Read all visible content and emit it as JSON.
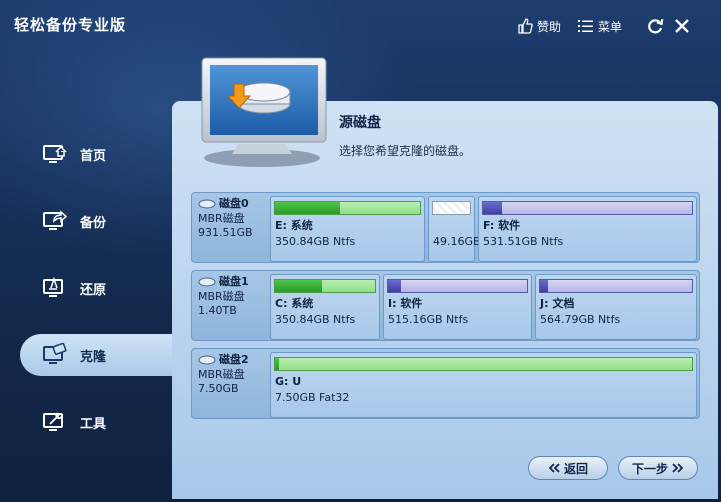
{
  "app": {
    "title": "轻松备份专业版"
  },
  "toolbar": {
    "like_label": "赞助",
    "menu_label": "菜单"
  },
  "sidebar": {
    "items": [
      {
        "label": "首页",
        "icon": "home-monitor-icon"
      },
      {
        "label": "备份",
        "icon": "backup-monitor-icon"
      },
      {
        "label": "还原",
        "icon": "restore-monitor-icon"
      },
      {
        "label": "克隆",
        "icon": "clone-monitor-icon",
        "active": true
      },
      {
        "label": "工具",
        "icon": "tools-monitor-icon"
      }
    ]
  },
  "main": {
    "title": "源磁盘",
    "subtitle": "选择您希望克隆的磁盘。"
  },
  "disks": [
    {
      "name": "磁盘0",
      "type": "MBR磁盘",
      "size": "931.51GB",
      "partitions": [
        {
          "label": "E: 系统",
          "size": "350.84GB Ntfs",
          "color": "green",
          "used": 0.45
        },
        {
          "label": "",
          "size": "49.16GB",
          "color": "blank",
          "used": 0
        },
        {
          "label": "F: 软件",
          "size": "531.51GB Ntfs",
          "color": "purple",
          "used": 0.09
        }
      ]
    },
    {
      "name": "磁盘1",
      "type": "MBR磁盘",
      "size": "1.40TB",
      "partitions": [
        {
          "label": "C: 系统",
          "size": "350.84GB Ntfs",
          "color": "green",
          "used": 0.47
        },
        {
          "label": "I: 软件",
          "size": "515.16GB Ntfs",
          "color": "purple",
          "used": 0.09
        },
        {
          "label": "J: 文档",
          "size": "564.79GB Ntfs",
          "color": "purple",
          "used": 0.05
        }
      ]
    },
    {
      "name": "磁盘2",
      "type": "MBR磁盘",
      "size": "7.50GB",
      "partitions": [
        {
          "label": "G: U",
          "size": "7.50GB Fat32",
          "color": "green",
          "used": 0.01
        }
      ]
    }
  ],
  "footer": {
    "back_label": "返回",
    "next_label": "下一步"
  }
}
